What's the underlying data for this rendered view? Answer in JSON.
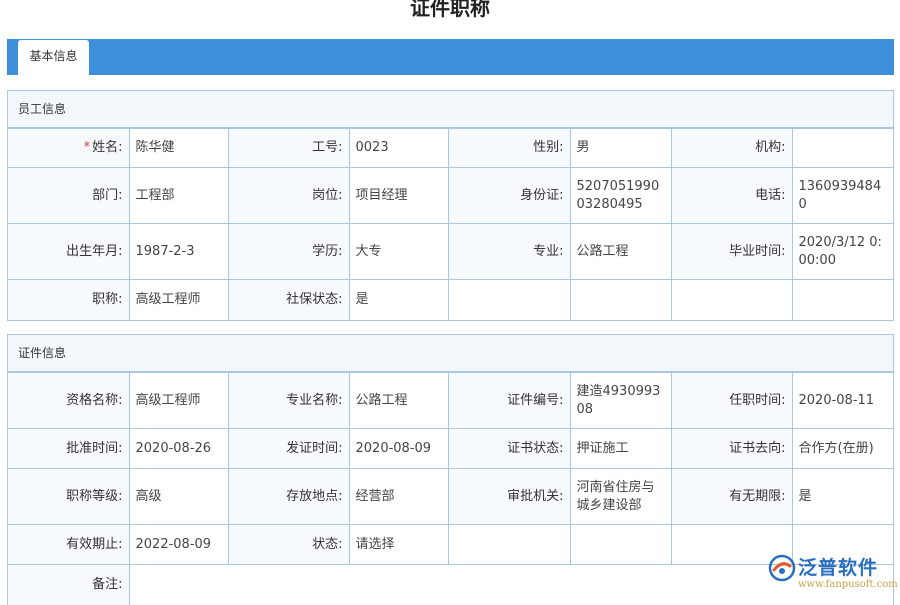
{
  "page": {
    "title": "证件职称"
  },
  "tabs": [
    {
      "label": "基本信息"
    }
  ],
  "employee": {
    "header": "员工信息",
    "name_label": "姓名:",
    "name": "陈华健",
    "id_label": "工号:",
    "id": "0023",
    "gender_label": "性别:",
    "gender": "男",
    "org_label": "机构:",
    "org": "",
    "dept_label": "部门:",
    "dept": "工程部",
    "post_label": "岗位:",
    "post": "项目经理",
    "idcard_label": "身份证:",
    "idcard": "520705199003280495",
    "phone_label": "电话:",
    "phone": "13609394840",
    "birth_label": "出生年月:",
    "birth": "1987-2-3",
    "edu_label": "学历:",
    "edu": "大专",
    "major_label": "专业:",
    "major": "公路工程",
    "grad_label": "毕业时间:",
    "grad": "2020/3/12 0:00:00",
    "title_label": "职称:",
    "title": "高级工程师",
    "social_label": "社保状态:",
    "social": "是"
  },
  "cert": {
    "header": "证件信息",
    "qual_label": "资格名称:",
    "qual": "高级工程师",
    "spec_label": "专业名称:",
    "spec": "公路工程",
    "no_label": "证件编号:",
    "no": "建造493099308",
    "appoint_label": "任职时间:",
    "appoint": "2020-08-11",
    "approve_label": "批准时间:",
    "approve": "2020-08-26",
    "issue_label": "发证时间:",
    "issue": "2020-08-09",
    "status_label": "证书状态:",
    "status": "押证施工",
    "dest_label": "证书去向:",
    "dest": "合作方(在册)",
    "level_label": "职称等级:",
    "level": "高级",
    "place_label": "存放地点:",
    "place": "经营部",
    "authority_label": "审批机关:",
    "authority": "河南省住房与城乡建设部",
    "indef_label": "有无期限:",
    "indef": "是",
    "expire_label": "有效期止:",
    "expire": "2022-08-09",
    "state_label": "状态:",
    "state": "请选择",
    "remark_label": "备注:",
    "remark": ""
  },
  "watermark": {
    "name": "泛普软件",
    "url": "www.fanpusoft.com"
  }
}
